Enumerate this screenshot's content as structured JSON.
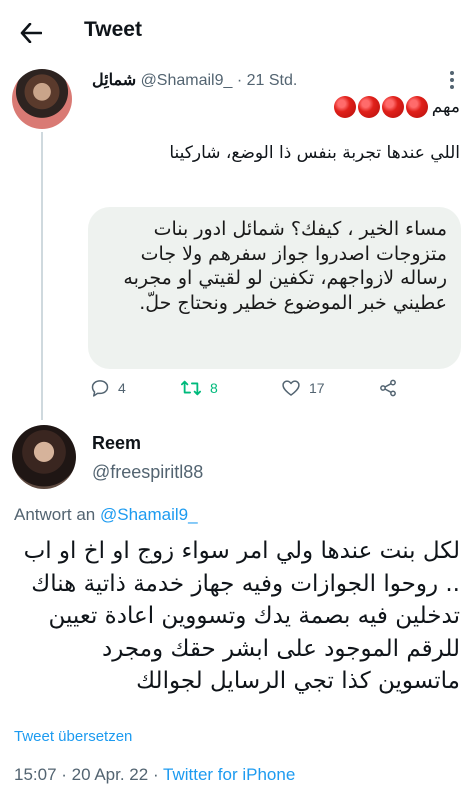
{
  "header": {
    "title": "Tweet",
    "back_icon": "arrow-left-icon"
  },
  "parent_tweet": {
    "author_name": "شمائِل",
    "handle": "@Shamail9_",
    "separator": "·",
    "time": "21 Std.",
    "emoji_text": "مهم",
    "emoji_count": 4,
    "text": "اللي عندها تجربة بنفس ذا الوضع، شاركينا",
    "quote_text": "مساء الخير ، كيفك؟ شمائل ادور بنات متزوجات اصدروا جواز سفرهم ولا جات رساله لازواجهم، تكفين لو لقيتي او مجربه عطيني خبر الموضوع خطير ونحتاج حلّ.",
    "actions": {
      "reply_count": "4",
      "retweet_count": "8",
      "like_count": "17"
    },
    "colors": {
      "retweet": "#00ba7c",
      "emoji_red": "#e0201a"
    }
  },
  "reply_tweet": {
    "author_name": "Reem",
    "handle": "@freespiritl88",
    "reply_prefix": "Antwort an",
    "reply_mention": "@Shamail9_",
    "text": "لكل بنت عندها ولي امر سواء زوج او اخ او اب .. روحوا الجوازات وفيه جهاز خدمة ذاتية هناك تدخلين فيه بصمة يدك وتسووين اعادة تعيين للرقم الموجود على ابشر حقك ومجرد ماتسوين كذا تجي الرسايل لجوالك",
    "translate_label": "Tweet übersetzen",
    "timestamp": "15:07 · 20 Apr. 22 · ",
    "source": "Twitter for iPhone"
  },
  "accent_color": "#1d9bf0"
}
